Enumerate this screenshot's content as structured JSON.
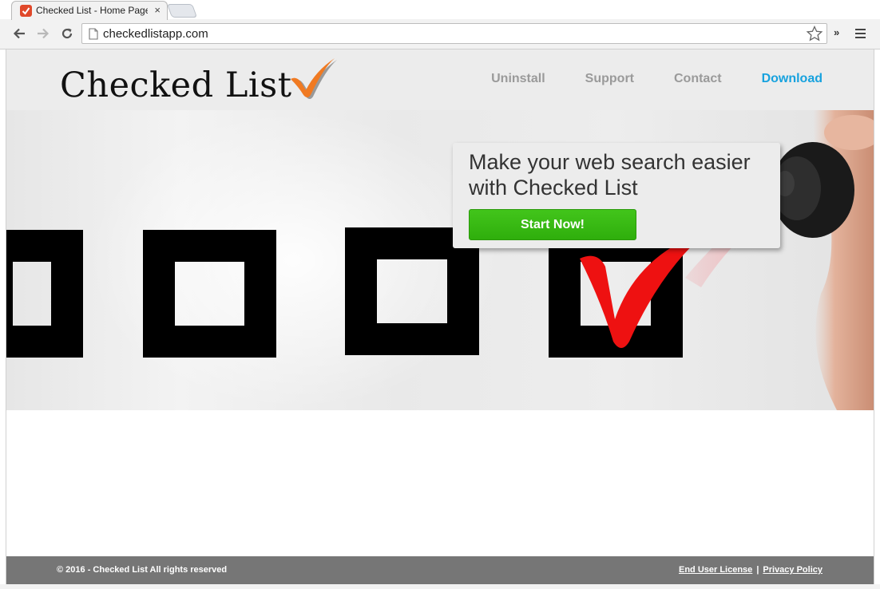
{
  "browser": {
    "tab": {
      "title": "Checked List - Home Page",
      "close_glyph": "×"
    },
    "address_bar": {
      "url": "checkedlistapp.com"
    },
    "extensions_chevron": "»"
  },
  "site": {
    "logo": {
      "text": "Checked List"
    },
    "nav": {
      "items": [
        {
          "label": "Uninstall"
        },
        {
          "label": "Support"
        },
        {
          "label": "Contact"
        },
        {
          "label": "Download"
        }
      ]
    },
    "hero": {
      "headline": "Make your web search easier with Checked List",
      "cta_label": "Start Now!"
    },
    "footer": {
      "copyright": "© 2016 - Checked List All rights reserved",
      "links": [
        {
          "label": "End User License"
        },
        {
          "label": "Privacy Policy"
        }
      ],
      "separator": "|"
    }
  },
  "colors": {
    "accent_link": "#17a2de",
    "cta_green": "#36b614",
    "logo_check_orange": "#f07a22",
    "checkmark_red": "#ee1111",
    "footer_gray": "#767676"
  }
}
